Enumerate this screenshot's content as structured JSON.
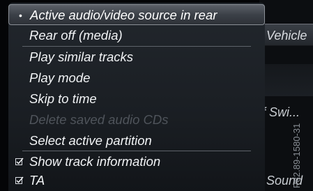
{
  "background": {
    "vehicle_label": "Vehicle",
    "switch_label": "f Swi...",
    "sound_label": "Sound"
  },
  "menu": {
    "items": [
      {
        "label": "Active audio/video source in rear",
        "state": "selected",
        "marker": "•"
      },
      {
        "label": "Rear off (media)",
        "state": "normal"
      },
      {
        "label": "Play similar tracks",
        "state": "normal"
      },
      {
        "label": "Play mode",
        "state": "normal"
      },
      {
        "label": "Skip to time",
        "state": "normal"
      },
      {
        "label": "Delete saved audio CDs",
        "state": "disabled"
      },
      {
        "label": "Select active partition",
        "state": "normal"
      },
      {
        "label": "Show track information",
        "state": "checked"
      },
      {
        "label": "TA",
        "state": "checked"
      }
    ]
  },
  "reference_code": "P82.89-1580-31",
  "colors": {
    "menu_bg": "#1a1e23",
    "selected_bg": "#3c4148",
    "text": "#f1f3f5",
    "disabled_text": "#4f545b"
  }
}
